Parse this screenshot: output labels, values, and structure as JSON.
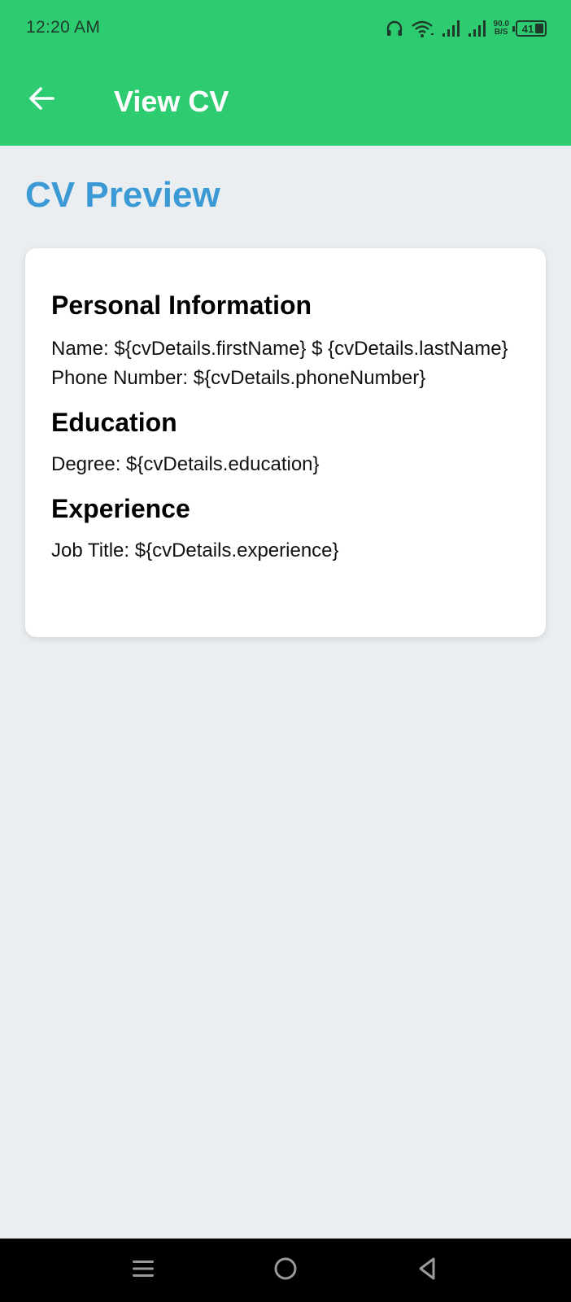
{
  "status_bar": {
    "time": "12:20 AM",
    "net_speed_value": "90.0",
    "net_speed_unit": "B/S",
    "battery": "41",
    "icons": [
      "headset-icon",
      "wifi-icon",
      "signal-icon",
      "signal-icon",
      "battery-icon"
    ]
  },
  "app_bar": {
    "title": "View CV",
    "back_icon": "arrow-left-icon"
  },
  "page": {
    "heading": "CV Preview"
  },
  "cv": {
    "personal": {
      "title": "Personal Information",
      "name_line": "Name: ${cvDetails.firstName} $ {cvDetails.lastName}",
      "phone_line": "Phone Number: ${cvDetails.phoneNumber}"
    },
    "education": {
      "title": "Education",
      "degree_line": "Degree: ${cvDetails.education}"
    },
    "experience": {
      "title": "Experience",
      "job_line": "Job Title: ${cvDetails.experience}"
    }
  },
  "nav_bar": {
    "icons": [
      "menu-icon",
      "home-circle-icon",
      "back-triangle-icon"
    ]
  },
  "colors": {
    "app_bar": "#2ECC71",
    "heading": "#3B9AD6",
    "background": "#EBEEF0",
    "card": "#FFFFFF",
    "nav_bar": "#000000"
  }
}
